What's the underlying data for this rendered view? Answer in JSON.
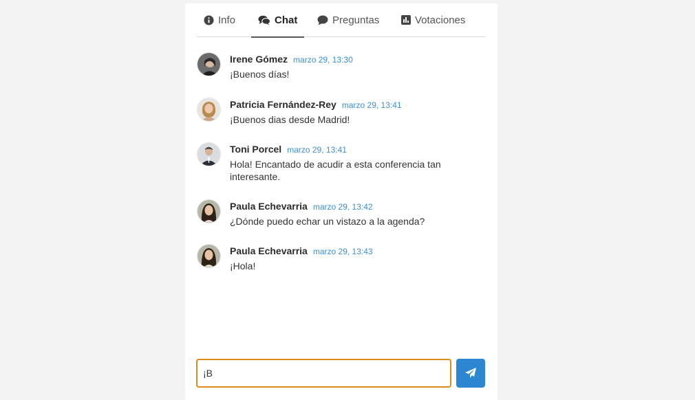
{
  "tabs": [
    {
      "label": "Info",
      "icon": "info-circle-icon"
    },
    {
      "label": "Chat",
      "icon": "comments-icon",
      "active": true
    },
    {
      "label": "Preguntas",
      "icon": "speech-bubble-icon"
    },
    {
      "label": "Votaciones",
      "icon": "bar-chart-icon"
    }
  ],
  "messages": [
    {
      "author": "Irene Gómez",
      "time": "marzo 29, 13:30",
      "text": "¡Buenos días!"
    },
    {
      "author": "Patricia Fernández-Rey",
      "time": "marzo 29, 13:41",
      "text": "¡Buenos dias desde Madrid!"
    },
    {
      "author": "Toni Porcel",
      "time": "marzo 29, 13:41",
      "text": "Hola! Encantado de acudir a esta conferencia tan interesante."
    },
    {
      "author": "Paula Echevarria",
      "time": "marzo 29, 13:42",
      "text": "¿Dónde puedo echar un vistazo a la agenda?"
    },
    {
      "author": "Paula Echevarria",
      "time": "marzo 29, 13:43",
      "text": "¡Hola!"
    }
  ],
  "composer": {
    "value": "¡B"
  },
  "colors": {
    "accent": "#2d86d2",
    "focus": "#e08a1e",
    "time": "#3a8fd6"
  }
}
